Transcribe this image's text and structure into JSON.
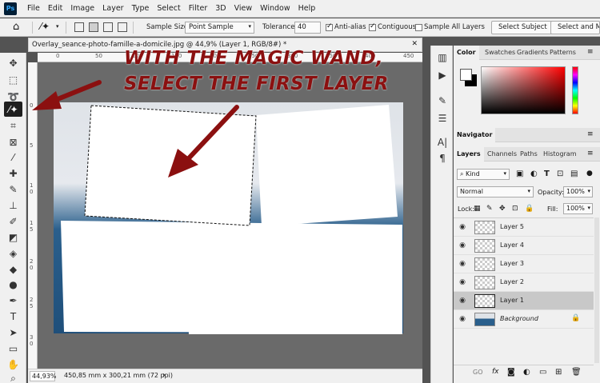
{
  "app": {
    "logo": "Ps"
  },
  "menu": [
    "File",
    "Edit",
    "Image",
    "Layer",
    "Type",
    "Select",
    "Filter",
    "3D",
    "View",
    "Window",
    "Help"
  ],
  "options": {
    "sample_size_label": "Sample Size:",
    "sample_size_value": "Point Sample",
    "tolerance_label": "Tolerance:",
    "tolerance_value": "40",
    "anti_alias": "Anti-alias",
    "contiguous": "Contiguous",
    "sample_all_layers": "Sample All Layers",
    "select_subject": "Select Subject",
    "select_and_mask": "Select and Ma"
  },
  "document": {
    "tab_title": "Overlay_seance-photo-famille-a-domicile.jpg @ 44,9% (Layer 1, RGB/8#) *",
    "ruler_top": [
      "0",
      "50",
      "100",
      "150",
      "200",
      "250",
      "300",
      "350",
      "400",
      "450"
    ],
    "ruler_left": [
      "0",
      "5",
      "1 0",
      "1 5",
      "2 0",
      "2 5",
      "3 0"
    ],
    "zoom": "44,93%",
    "doc_info": "450,85 mm x 300,21 mm (72 ppi)",
    "status_arrow": "›"
  },
  "annotation": {
    "line1": "WITH THE MAGIC WAND,",
    "line2": "SELECT THE FIRST LAYER",
    "color": "#8b1010"
  },
  "panels": {
    "color_tabs": [
      "Color",
      "Swatches",
      "Gradients",
      "Patterns"
    ],
    "navigator_tab": "Navigator",
    "layers_tabs": [
      "Layers",
      "Channels",
      "Paths",
      "Histogram"
    ],
    "kind_label": "Kind",
    "blend_mode": "Normal",
    "opacity_label": "Opacity:",
    "opacity_value": "100%",
    "lock_label": "Lock:",
    "fill_label": "Fill:",
    "fill_value": "100%",
    "layers": [
      {
        "name": "Layer 5",
        "selected": false
      },
      {
        "name": "Layer 4",
        "selected": false
      },
      {
        "name": "Layer 3",
        "selected": false
      },
      {
        "name": "Layer 2",
        "selected": false
      },
      {
        "name": "Layer 1",
        "selected": true
      },
      {
        "name": "Background",
        "selected": false
      }
    ],
    "footer_icons": [
      "GO",
      "fx"
    ]
  }
}
